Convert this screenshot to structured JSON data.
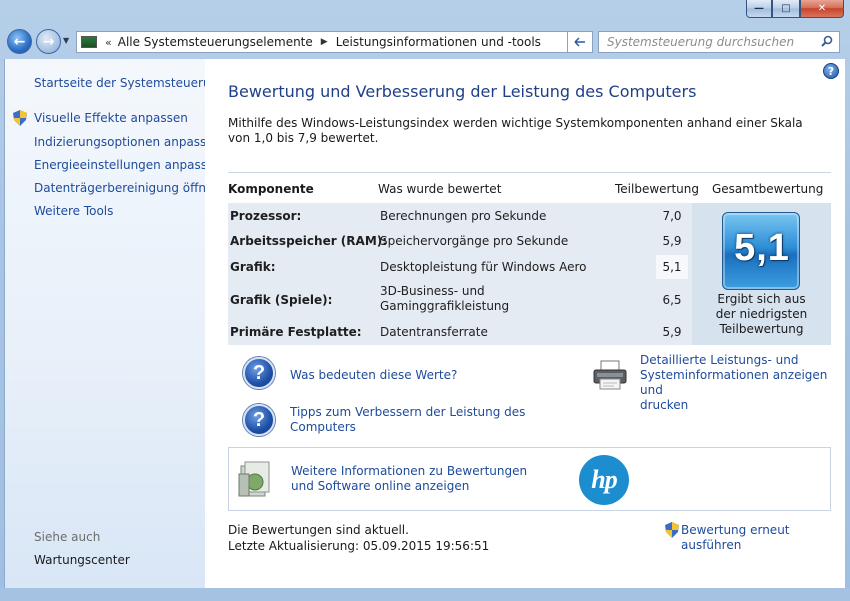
{
  "window": {
    "caption_buttons": [
      "minimize",
      "maximize",
      "close"
    ]
  },
  "navigation": {
    "breadcrumb": [
      "Alle Systemsteuerungselemente",
      "Leistungsinformationen und -tools"
    ],
    "search_placeholder": "Systemsteuerung durchsuchen"
  },
  "sidebar": {
    "home": "Startseite der Systemsteuerung",
    "items": [
      {
        "label": "Visuelle Effekte anpassen",
        "icon": "uac-shield-icon"
      },
      {
        "label": "Indizierungsoptionen anpassen"
      },
      {
        "label": "Energieeinstellungen anpassen"
      },
      {
        "label": "Datenträgerbereinigung öffnen"
      },
      {
        "label": "Weitere Tools"
      }
    ],
    "see_also_heading": "Siehe auch",
    "see_also": [
      "Wartungscenter"
    ]
  },
  "main": {
    "title": "Bewertung und Verbesserung der Leistung des Computers",
    "description": "Mithilfe des Windows-Leistungsindex werden wichtige Systemkomponenten anhand einer Skala von 1,0 bis 7,9 bewertet.",
    "table": {
      "headers": [
        "Komponente",
        "Was wurde bewertet",
        "Teilbewertung",
        "Gesamtbewertung"
      ],
      "rows": [
        {
          "component": "Prozessor:",
          "rated": "Berechnungen pro Sekunde",
          "score": "7,0"
        },
        {
          "component": "Arbeitsspeicher (RAM):",
          "rated": "Speichervorgänge pro Sekunde",
          "score": "5,9"
        },
        {
          "component": "Grafik:",
          "rated": "Desktopleistung für Windows Aero",
          "score": "5,1"
        },
        {
          "component": "Grafik (Spiele):",
          "rated_line1": "3D-Business- und",
          "rated_line2": "Gaminggrafikleistung",
          "score": "6,5"
        },
        {
          "component": "Primäre Festplatte:",
          "rated": "Datentransferrate",
          "score": "5,9"
        }
      ],
      "base_score": "5,1",
      "base_caption": [
        "Ergibt sich aus",
        "der niedrigsten",
        "Teilbewertung"
      ]
    },
    "links": {
      "what_mean": "Was bedeuten diese Werte?",
      "tips": [
        "Tipps zum Verbessern der Leistung des",
        "Computers"
      ],
      "detailed": [
        "Detaillierte Leistungs- und",
        "Systeminformationen anzeigen und",
        "drucken"
      ],
      "more_info": [
        "Weitere Informationen zu Bewertungen",
        "und Software online anzeigen"
      ],
      "rerun": "Bewertung erneut ausführen"
    },
    "hp_logo_text": "hp",
    "status": "Die Bewertungen sind aktuell.",
    "last_update": "Letzte Aktualisierung: 05.09.2015 19:56:51"
  },
  "colors": {
    "link": "#1e4b9a",
    "title": "#1e3f8a",
    "hp_blue": "#1c8ed0"
  }
}
